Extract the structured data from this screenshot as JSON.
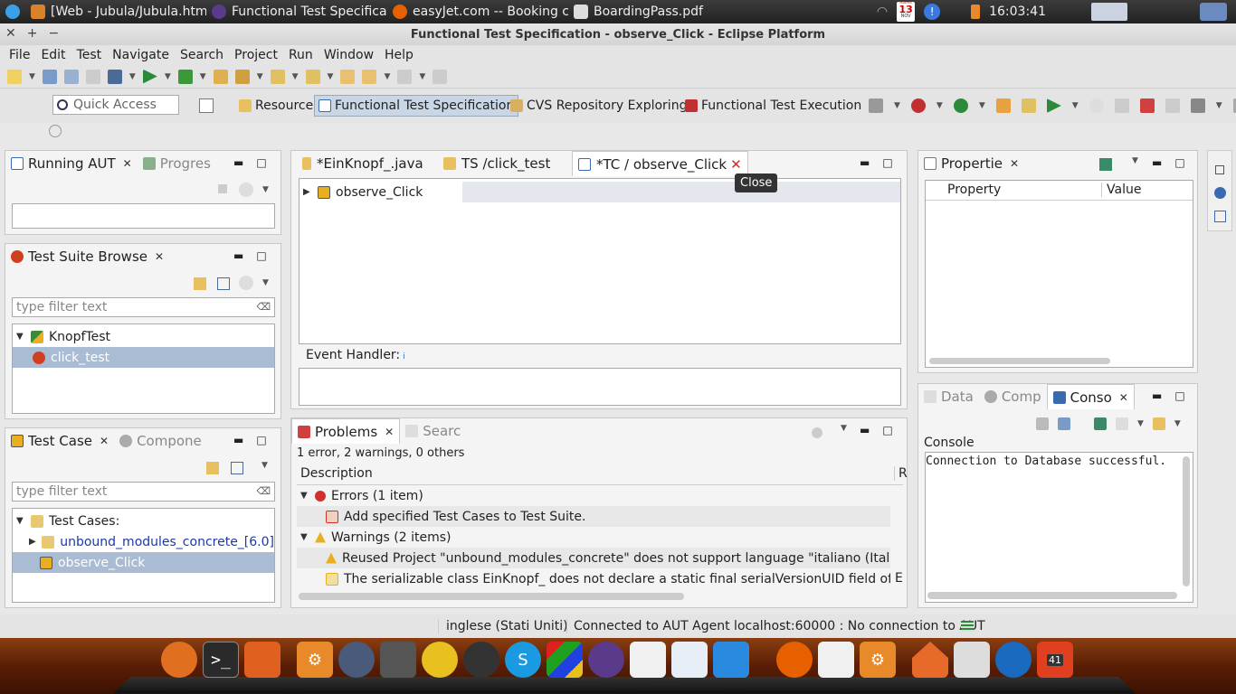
{
  "system_bar": {
    "tabs": [
      "[Web - Jubula/Jubula.htm...",
      "Functional Test Specificat...",
      "easyJet.com -- Booking c...",
      "BoardingPass.pdf"
    ],
    "time": "16:03:41",
    "calendar_month": "NOV",
    "calendar_day": "13",
    "calendar_weekday": "MARTEDÌ"
  },
  "window": {
    "title": "Functional Test Specification - observe_Click - Eclipse Platform"
  },
  "menu": [
    "File",
    "Edit",
    "Test",
    "Navigate",
    "Search",
    "Project",
    "Run",
    "Window",
    "Help"
  ],
  "quick_access": {
    "placeholder": "Quick Access"
  },
  "perspectives": {
    "resource": "Resource",
    "fts": "Functional Test Specification",
    "cvs": "CVS Repository Exploring",
    "fte": "Functional Test Execution"
  },
  "running_aut": {
    "tab": "Running AUT",
    "tab2": "Progres"
  },
  "test_suite_browser": {
    "tab": "Test Suite Browse",
    "filter_placeholder": "type filter text",
    "items": [
      "KnopfTest",
      "click_test"
    ]
  },
  "test_case_panel": {
    "tab": "Test Case",
    "tab2": "Compone",
    "filter_placeholder": "type filter text",
    "items": [
      "Test Cases:",
      "unbound_modules_concrete_[6.0]",
      "observe_Click"
    ]
  },
  "editor": {
    "tabs": [
      "*EinKnopf_.java",
      "TS /click_test",
      "*TC / observe_Click"
    ],
    "tooltip": "Close",
    "root_node": "observe_Click",
    "event_handler_label": "Event Handler:",
    "info_mark": "i"
  },
  "problems": {
    "tab": "Problems",
    "tab2": "Searc",
    "summary": "1 error, 2 warnings, 0 others",
    "col_description": "Description",
    "col_r": "R",
    "errors_group": "Errors (1 item)",
    "error_1": "Add specified Test Cases to Test Suite.",
    "warnings_group": "Warnings (2 items)",
    "warning_1": "Reused Project \"unbound_modules_concrete\" does not support language \"italiano (Italia)\". Eit",
    "warning_2": "The serializable class EinKnopf_ does not declare a static final serialVersionUID field of type l",
    "warning_2_col": "E"
  },
  "properties": {
    "tab": "Propertie",
    "col_property": "Property",
    "col_value": "Value"
  },
  "console": {
    "tab_data": "Data",
    "tab_comp": "Comp",
    "tab": "Conso",
    "label": "Console",
    "text": "Connection to Database successful."
  },
  "status_bar": {
    "language": "inglese (Stati Uniti)",
    "connection": "Connected to AUT Agent localhost:60000 : No connection to AUT"
  },
  "dock": {
    "badge": "41"
  },
  "colors": {
    "selection": "#a9bcd3",
    "error": "#d03030",
    "warning": "#e8b020"
  }
}
